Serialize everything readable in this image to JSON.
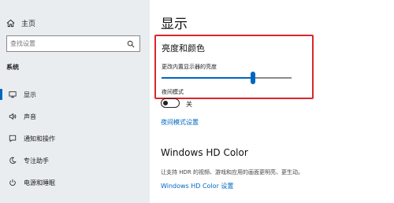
{
  "sidebar": {
    "home_label": "主页",
    "search_placeholder": "查找设置",
    "section_label": "系统",
    "items": [
      {
        "label": "显示",
        "icon": "monitor-icon"
      },
      {
        "label": "声音",
        "icon": "speaker-icon"
      },
      {
        "label": "通知和操作",
        "icon": "notification-icon"
      },
      {
        "label": "专注助手",
        "icon": "moon-icon"
      },
      {
        "label": "电源和睡眠",
        "icon": "power-icon"
      }
    ],
    "active_index": 0
  },
  "main": {
    "title": "显示",
    "brightness_section": {
      "heading": "亮度和颜色",
      "slider_label": "更改内置显示器的亮度",
      "brightness_percent": 70
    },
    "night_light": {
      "label": "夜间模式",
      "state_label": "关",
      "settings_link": "夜间模式设置"
    },
    "hd_color": {
      "heading": "Windows HD Color",
      "description": "让支持 HDR 的视频、游戏和应用的画面更明亮、更生动。",
      "settings_link": "Windows HD Color 设置"
    }
  },
  "colors": {
    "accent": "#0067c0",
    "highlight_border": "#d9272e",
    "sidebar_bg": "#e9edf0"
  }
}
